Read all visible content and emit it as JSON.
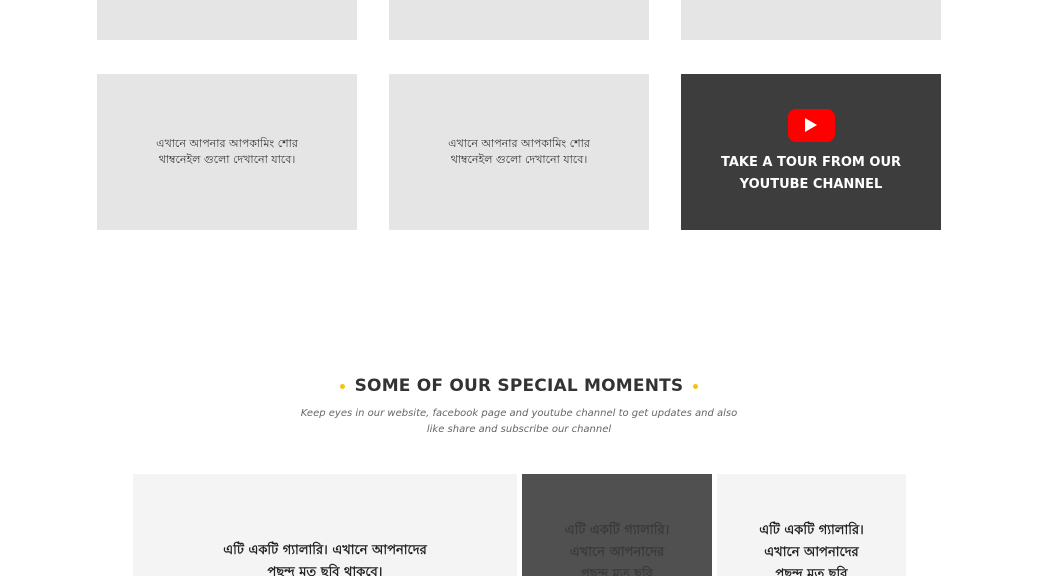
{
  "upcoming": {
    "thumb_text": "এখানে আপনার আপকামিং শোর থাম্বনেইল গুলো দেখানো যাবে।"
  },
  "youtube": {
    "icon": "youtube-play-icon",
    "cta": "TAKE A TOUR FROM OUR YOUTUBE CHANNEL",
    "brand_color": "#ff0000"
  },
  "moments": {
    "title": "SOME OF OUR SPECIAL MOMENTS",
    "subtitle": "Keep eyes in our website, facebook page and youtube channel to get updates and also like share and subscribe our channel",
    "accent_color": "#f1c40f"
  },
  "gallery": [
    {
      "text": "এটি একটি গ্যালারি। এখানে আপনাদের পছন্দ মত ছবি থাকবে।"
    },
    {
      "text": "এটি একটি গ্যালারি। এখানে আপনাদের পছন্দ মত ছবি থাকবে।"
    },
    {
      "text": "এটি একটি গ্যালারি। এখানে আপনাদের পছন্দ মত ছবি থাকবে।"
    }
  ]
}
